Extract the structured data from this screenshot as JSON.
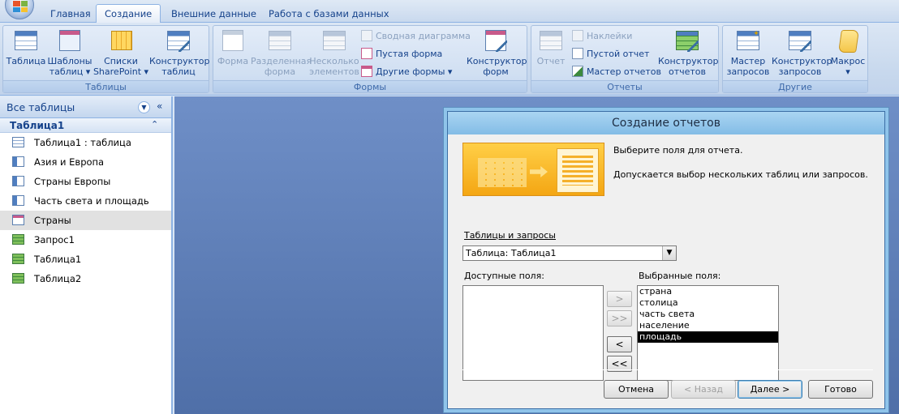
{
  "tabs": [
    {
      "label": "Главная"
    },
    {
      "label": "Создание"
    },
    {
      "label": "Внешние данные"
    },
    {
      "label": "Работа с базами данных"
    }
  ],
  "ribbon": {
    "tables": {
      "label": "Таблицы",
      "table": "Таблица",
      "templates_1": "Шаблоны",
      "templates_2": "таблиц ▾",
      "lists_1": "Списки",
      "lists_2": "SharePoint ▾",
      "designer_1": "Конструктор",
      "designer_2": "таблиц"
    },
    "forms": {
      "label": "Формы",
      "form": "Форма",
      "split_1": "Разделенная",
      "split_2": "форма",
      "multi_1": "Несколько",
      "multi_2": "элементов",
      "pivot": "Сводная диаграмма",
      "blank": "Пустая форма",
      "other": "Другие формы ▾",
      "designer_1": "Конструктор",
      "designer_2": "форм"
    },
    "reports": {
      "label": "Отчеты",
      "report": "Отчет",
      "labels": "Наклейки",
      "blank": "Пустой отчет",
      "wizard": "Мастер отчетов",
      "designer_1": "Конструктор",
      "designer_2": "отчетов"
    },
    "other": {
      "label": "Другие",
      "qwizard_1": "Мастер",
      "qwizard_2": "запросов",
      "qdesigner_1": "Конструктор",
      "qdesigner_2": "запросов",
      "macro": "Макрос",
      "macro_arrow": "▾"
    }
  },
  "nav": {
    "header": "Все таблицы",
    "group": "Таблица1",
    "items": [
      {
        "label": "Таблица1 : таблица",
        "kind": "table"
      },
      {
        "label": "Азия и Европа",
        "kind": "query"
      },
      {
        "label": "Страны Европы",
        "kind": "query"
      },
      {
        "label": "Часть света и площадь",
        "kind": "query"
      },
      {
        "label": "Страны",
        "kind": "form"
      },
      {
        "label": "Запрос1",
        "kind": "report"
      },
      {
        "label": "Таблица1",
        "kind": "report"
      },
      {
        "label": "Таблица2",
        "kind": "report"
      }
    ]
  },
  "dialog": {
    "title": "Создание отчетов",
    "prompt1": "Выберите поля для отчета.",
    "prompt2": "Допускается выбор нескольких таблиц или запросов.",
    "tables_label": "Таблицы и запросы",
    "table_value": "Таблица: Таблица1",
    "available_label": "Доступные поля:",
    "selected_label": "Выбранные поля:",
    "available_fields": [],
    "selected_fields": [
      "страна",
      "столица",
      "часть света",
      "население",
      "площадь"
    ],
    "selected_index": 4,
    "move": {
      "one": ">",
      "all": ">>",
      "back_one": "<",
      "back_all": "<<"
    },
    "buttons": {
      "cancel": "Отмена",
      "back": "< Назад",
      "next": "Далее >",
      "finish": "Готово"
    }
  }
}
